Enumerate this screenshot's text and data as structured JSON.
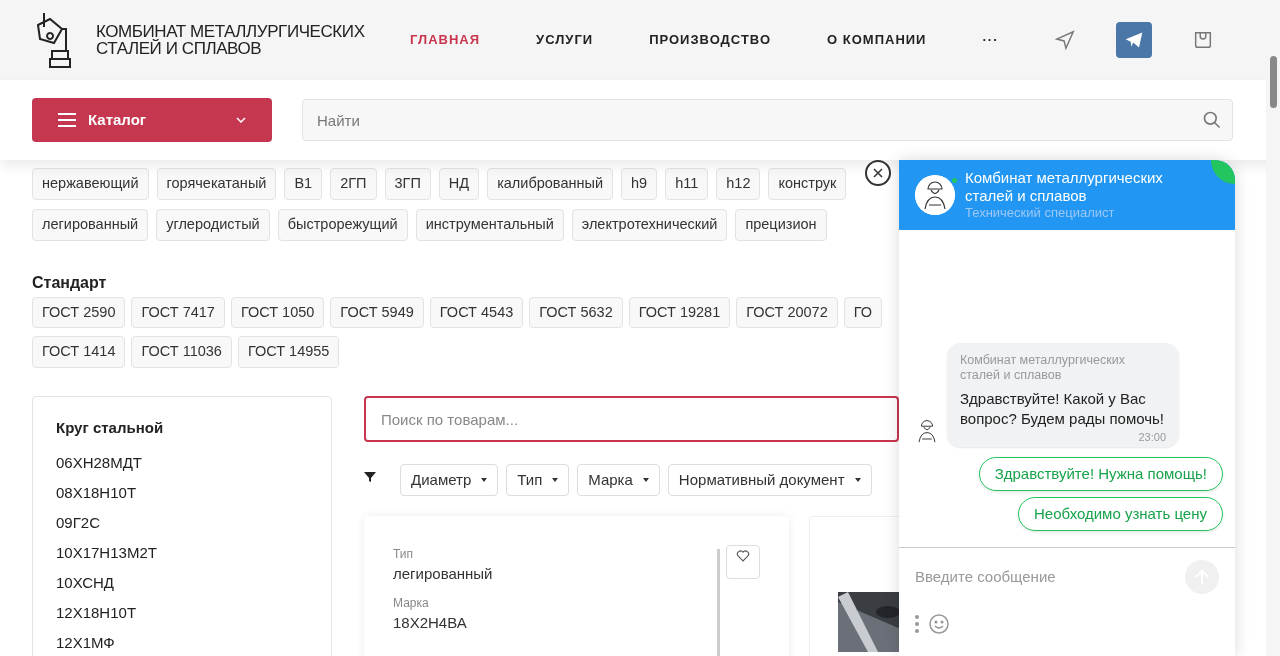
{
  "logo": {
    "line1": "КОМБИНАТ МЕТАЛЛУРГИЧЕСКИХ",
    "line2": "СТАЛЕЙ И СПЛАВОВ"
  },
  "nav": [
    {
      "label": "ГЛАВНАЯ",
      "selected": true
    },
    {
      "label": "УСЛУГИ",
      "selected": false
    },
    {
      "label": "ПРОИЗВОДСТВО",
      "selected": false
    },
    {
      "label": "О КОМПАНИИ",
      "selected": false
    },
    {
      "label": "···",
      "selected": false
    }
  ],
  "catalog_button": "Каталог",
  "search": {
    "placeholder": "Найти"
  },
  "tag_rows": [
    [
      "нержавеющий",
      "горячекатаный",
      "В1",
      "2ГП",
      "3ГП",
      "НД",
      "калиброванный",
      "h9",
      "h11",
      "h12",
      "конструк"
    ],
    [
      "легированный",
      "углеродистый",
      "быстрорежущий",
      "инструментальный",
      "электротехнический",
      "прецизион"
    ]
  ],
  "standard": {
    "title": "Стандарт",
    "rows": [
      [
        "ГОСТ 2590",
        "ГОСТ 7417",
        "ГОСТ 1050",
        "ГОСТ 5949",
        "ГОСТ 4543",
        "ГОСТ 5632",
        "ГОСТ 19281",
        "ГОСТ 20072",
        "ГО"
      ],
      [
        "ГОСТ 1414",
        "ГОСТ 11036",
        "ГОСТ 14955"
      ]
    ]
  },
  "sidebar": {
    "title": "Круг стальной",
    "items": [
      "06ХН28МДТ",
      "08Х18Н10Т",
      "09Г2С",
      "10Х17Н13М2Т",
      "10ХСНД",
      "12Х18Н10Т",
      "12Х1МФ"
    ]
  },
  "product_search": {
    "placeholder": "Поиск по товарам..."
  },
  "filters": [
    "Диаметр",
    "Тип",
    "Марка",
    "Нормативный документ"
  ],
  "product_card": {
    "fields": [
      {
        "label": "Тип",
        "value": "легированный"
      },
      {
        "label": "Марка",
        "value": "18Х2Н4ВА"
      }
    ]
  },
  "chat": {
    "name": "Комбинат металлургических сталей и сплавов",
    "role": "Технический специалист",
    "message": {
      "sender": "Комбинат металлургических сталей и сплавов",
      "text": "Здравствуйте! Какой у Вас вопрос? Будем рады помочь!",
      "time": "23:00"
    },
    "quick_replies": [
      "Здравствуйте! Нужна помощь!",
      "Необходимо узнать цену"
    ],
    "input": {
      "placeholder": "Введите сообщение"
    }
  }
}
